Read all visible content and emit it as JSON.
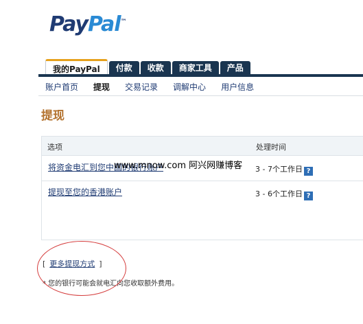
{
  "logo": {
    "part1": "Pay",
    "part2": "Pal",
    "tm": "™"
  },
  "tabs": [
    {
      "label": "我的PayPal",
      "active": true
    },
    {
      "label": "付款",
      "active": false
    },
    {
      "label": "收款",
      "active": false
    },
    {
      "label": "商家工具",
      "active": false
    },
    {
      "label": "产品",
      "active": false
    }
  ],
  "subnav": [
    {
      "label": "账户首页",
      "active": false
    },
    {
      "label": "提现",
      "active": true
    },
    {
      "label": "交易记录",
      "active": false
    },
    {
      "label": "调解中心",
      "active": false
    },
    {
      "label": "用户信息",
      "active": false
    }
  ],
  "page_title": "提现",
  "table": {
    "headers": {
      "option": "选项",
      "time": "处理时间"
    },
    "rows": [
      {
        "option": "将资金电汇到您中国的银行账户",
        "time": "3 - 7个工作日",
        "help": "?"
      },
      {
        "option": "提现至您的香港账户",
        "time": "3 - 6个工作日",
        "help": "?"
      }
    ]
  },
  "watermark": "www.mnow.com 阿兴网赚博客",
  "more": {
    "open": "[",
    "label": "更多提现方式",
    "close": "]"
  },
  "note": "* 您的银行可能会就电汇向您收取额外费用。",
  "colors": {
    "nav_dark": "#1a3550",
    "tab_accent": "#e6a11c",
    "title_brown": "#b3722e",
    "link_blue": "#1f3b73",
    "annotation_red": "#d43a3a"
  }
}
